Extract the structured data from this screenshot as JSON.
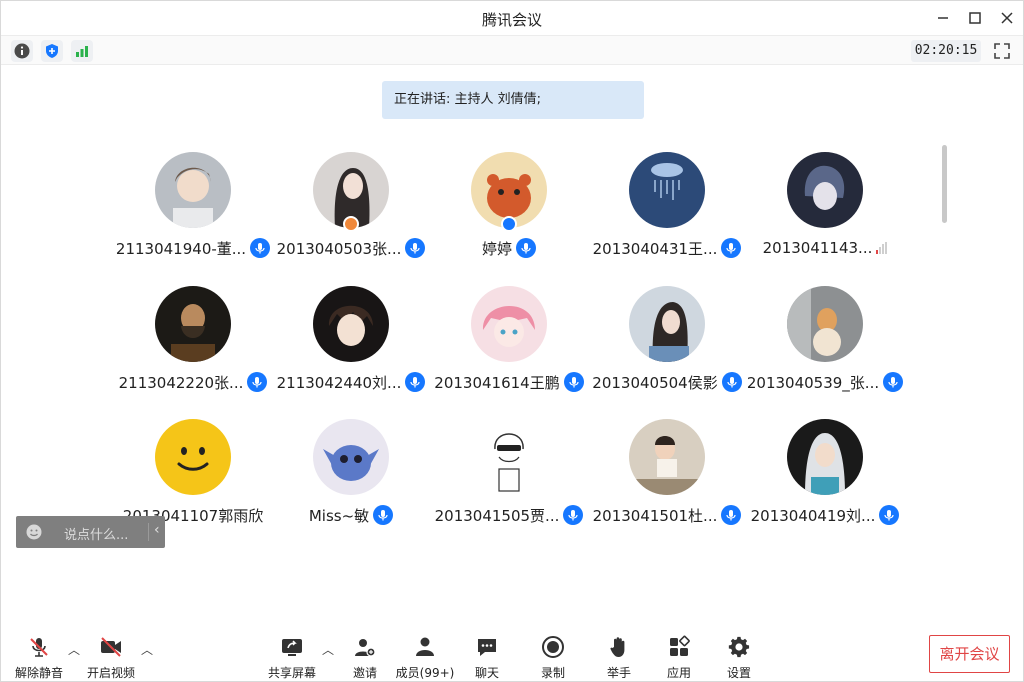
{
  "window": {
    "title": "腾讯会议"
  },
  "statusbar": {
    "timer": "02:20:15"
  },
  "speaking": {
    "text": "正在讲话: 主持人  刘倩倩;"
  },
  "participants": [
    {
      "name": "2113041940-董...",
      "mic": true
    },
    {
      "name": "2013040503张...",
      "mic": true,
      "badge": "host"
    },
    {
      "name": "婷婷",
      "mic": true,
      "badge": "cohost"
    },
    {
      "name": "2013040431王...",
      "mic": true
    },
    {
      "name": "2013041143...",
      "mic": false,
      "signal": true
    },
    {
      "name": "2113042220张...",
      "mic": true
    },
    {
      "name": "2113042440刘...",
      "mic": true
    },
    {
      "name": "2013041614王鹏",
      "mic": true
    },
    {
      "name": "2013040504侯影",
      "mic": true
    },
    {
      "name": "2013040539_张...",
      "mic": true
    },
    {
      "name": "2013041107郭雨欣",
      "mic": false
    },
    {
      "name": "Miss~敏",
      "mic": true
    },
    {
      "name": "2013041505贾...",
      "mic": true
    },
    {
      "name": "2013041501杜...",
      "mic": true
    },
    {
      "name": "2013040419刘...",
      "mic": true
    }
  ],
  "chat": {
    "placeholder": "说点什么..."
  },
  "toolbar": {
    "mute": "解除静音",
    "video": "开启视频",
    "share": "共享屏幕",
    "invite": "邀请",
    "members": "成员(99+)",
    "chat": "聊天",
    "record": "录制",
    "raise_hand": "举手",
    "apps": "应用",
    "settings": "设置",
    "leave": "离开会议"
  },
  "colors": {
    "accent": "#1677ff",
    "leave": "#e04545",
    "signal_green": "#2bb24c",
    "host_badge": "#f0883a"
  }
}
